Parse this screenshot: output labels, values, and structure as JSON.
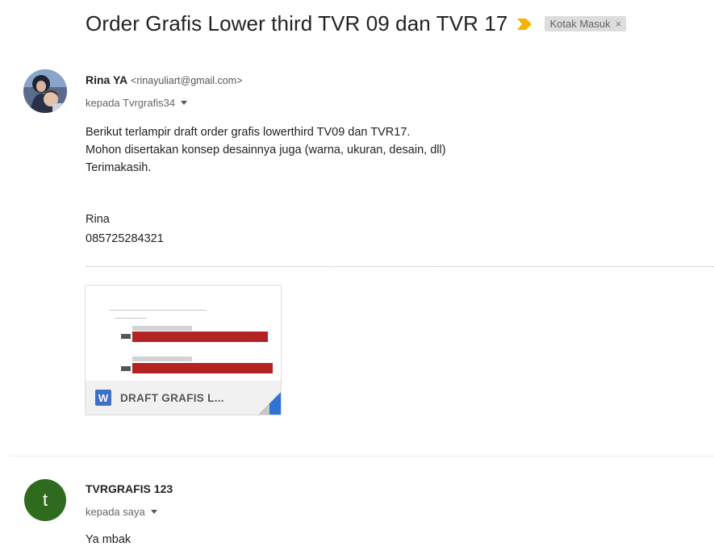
{
  "thread": {
    "subject": "Order Grafis Lower third TVR 09 dan TVR 17",
    "label_chip": "Kotak Masuk",
    "label_remove_glyph": "×",
    "importance_color": "#f4b400"
  },
  "message1": {
    "sender_name": "Rina YA",
    "sender_email": "<rinayuliart@gmail.com>",
    "recipient": "kepada Tvrgrafis34",
    "body_lines": [
      "Berikut terlampir draft order grafis lowerthird TV09 dan TVR17.",
      "Mohon disertakan konsep desainnya juga (warna, ukuran, desain, dll)",
      "Terimakasih."
    ],
    "signature": {
      "name": "Rina",
      "phone": "085725284321"
    },
    "attachment": {
      "icon_letter": "W",
      "name": "DRAFT GRAFIS L...",
      "icon": "word-doc-icon",
      "icon_color": "#3f6fc6"
    }
  },
  "message2": {
    "avatar_letter": "t",
    "avatar_color": "#2e6b1f",
    "sender_name": "TVRGRAFIS 123",
    "recipient": "kepada saya",
    "body": "Ya mbak"
  }
}
